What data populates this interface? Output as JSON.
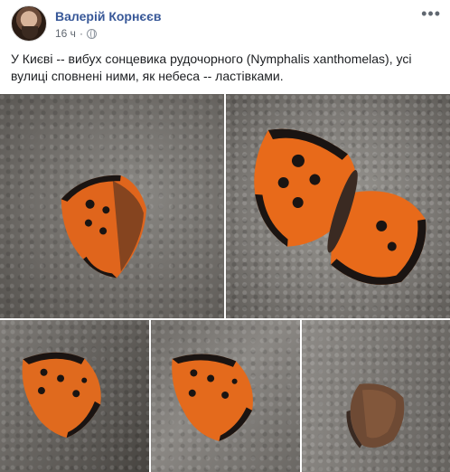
{
  "post": {
    "author": "Валерій Корнєєв",
    "time": "16 ч",
    "separator": "·",
    "more": "•••",
    "text": "У Києві -- вибух сонцевика рудочорного (Nymphalis xanthomelas), усі вулиці сповнені ними, як небеса -- ластівками."
  },
  "photos": {
    "count": 5,
    "icons": [
      "globe-icon",
      "more-icon"
    ]
  },
  "colors": {
    "author_link": "#385898",
    "meta_text": "#606770",
    "body_text": "#1c1e21",
    "wing_orange": "#e8671a",
    "wing_black": "#1a1412"
  }
}
